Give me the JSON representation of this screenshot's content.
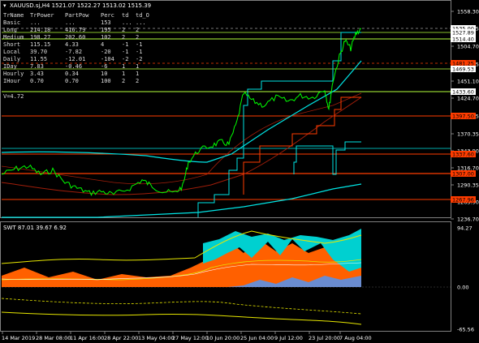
{
  "header": {
    "title": "XAUUSD.sj,H4  1521.07 1522.27 1513.02 1515.39"
  },
  "stats_table": {
    "columns": [
      "TrName",
      "TrPower",
      "PartPow",
      "Perc",
      "td",
      "td_O"
    ],
    "rows": [
      [
        "Basic",
        "...",
        "...",
        "153",
        "...",
        "..."
      ],
      [
        "Long",
        "214.18",
        "416.79",
        "195",
        "2",
        "2"
      ],
      [
        "Medium",
        "198.27",
        "202.60",
        "102",
        "2",
        "2"
      ],
      [
        "Short",
        "115.15",
        "4.33",
        "4",
        "-1",
        "-1"
      ],
      [
        "Local",
        "39.70",
        "-7.82",
        "-20",
        "-1",
        "-1"
      ],
      [
        "Daily",
        "11.55",
        "-12.01",
        "-104",
        "-2",
        "-2"
      ],
      [
        "IDay",
        "7.83",
        "-0.46",
        "-6",
        "1",
        "1"
      ],
      [
        "Hourly",
        "3.43",
        "0.34",
        "10",
        "1",
        "1"
      ],
      [
        "IHour",
        "0.70",
        "0.70",
        "100",
        "2",
        "2"
      ]
    ],
    "vlabel": "V=4.72"
  },
  "price_axis": {
    "ticks": [
      "1558.30",
      "1531.65",
      "1504.70",
      "1478.05",
      "1451.10",
      "1424.70",
      "1397.75",
      "1370.35",
      "1343.90",
      "1316.70",
      "1290.35",
      "1263.90",
      "1236.70"
    ],
    "tags": [
      {
        "text": "1535.00",
        "bg": "#ffffff",
        "fg": "#000000"
      },
      {
        "text": "1527.89",
        "bg": "#ffffff",
        "fg": "#000000"
      },
      {
        "text": "1514.40",
        "bg": "#ffffff",
        "fg": "#000000"
      },
      {
        "text": "1481.25",
        "bg": "#ff3c00",
        "fg": "#000000"
      },
      {
        "text": "1469.53",
        "bg": "#ffffff",
        "fg": "#000000"
      },
      {
        "text": "1433.60",
        "bg": "#ffffff",
        "fg": "#000000"
      },
      {
        "text": "1397.50",
        "bg": "#ff3c00",
        "fg": "#000000"
      },
      {
        "text": "1337.60",
        "bg": "#ff3c00",
        "fg": "#000000"
      },
      {
        "text": "1307.00",
        "bg": "#ff3c00",
        "fg": "#000000"
      },
      {
        "text": "1267.96",
        "bg": "#ff3c00",
        "fg": "#000000"
      }
    ]
  },
  "indicator": {
    "label": "SWT 87.01 39.67 6.92",
    "ticks": [
      "94.27",
      "0.00",
      "-65.56"
    ]
  },
  "time_axis": {
    "labels": [
      "14 Mar 2019",
      "28 Mar 08:00",
      "11 Apr 16:00",
      "28 Apr 22:00",
      "13 May 04:00",
      "27 May 12:00",
      "10 Jun 20:00",
      "25 Jun 04:00",
      "9 Jul 12:00",
      "23 Jul 20:00",
      "7 Aug 04:00"
    ]
  },
  "colors": {
    "price": "#00ff00",
    "cyan": "#00e5e5",
    "level_red": "#ff3c00",
    "level_yellowgreen": "#b4ff3c",
    "ma_dark_red": "#a01e0a",
    "ind_orange": "#ff6000",
    "ind_cyan": "#00d0d0",
    "ind_blue": "#6a8cd0",
    "ind_yellow": "#e6e600"
  }
}
